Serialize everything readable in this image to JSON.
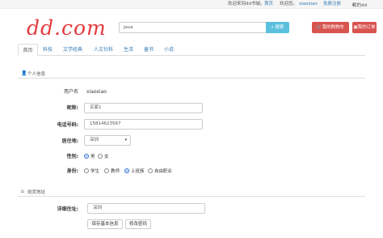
{
  "topbar": {
    "welcome": "欢迎来到dd书城。",
    "home": "首页",
    "greeting": "欢迎您。",
    "username": "xiaoxiao",
    "register": "免费注册",
    "my_dd": "我的dd"
  },
  "header": {
    "logo": "dd.com",
    "search_value": "java",
    "search_button": "搜索",
    "cart_button": "我的购物车",
    "orders_button": "我的订单"
  },
  "nav": {
    "tabs": [
      "首页",
      "科技",
      "文学经典",
      "人文社科",
      "生活",
      "童书",
      "小说"
    ],
    "active": 0
  },
  "personal": {
    "title": "个人信息",
    "username_label": "用户名",
    "username_value": "xiaoxiao",
    "nickname_label": "昵称:",
    "nickname_value": "买家1",
    "phone_label": "电话号码:",
    "phone_value": "15814623567",
    "residence_label": "居住地:",
    "residence_value": "深圳",
    "gender_label": "性别:",
    "gender_options": [
      "男",
      "女"
    ],
    "gender_selected": 0,
    "identity_label": "身份:",
    "identity_options": [
      "学生",
      "教师",
      "上班族",
      "自由职业"
    ],
    "identity_selected": 2
  },
  "address": {
    "title": "收货地址",
    "detail_label": "详细住址:",
    "detail_value": "深圳",
    "save_button": "保存基本信息",
    "password_button": "修改密码"
  }
}
